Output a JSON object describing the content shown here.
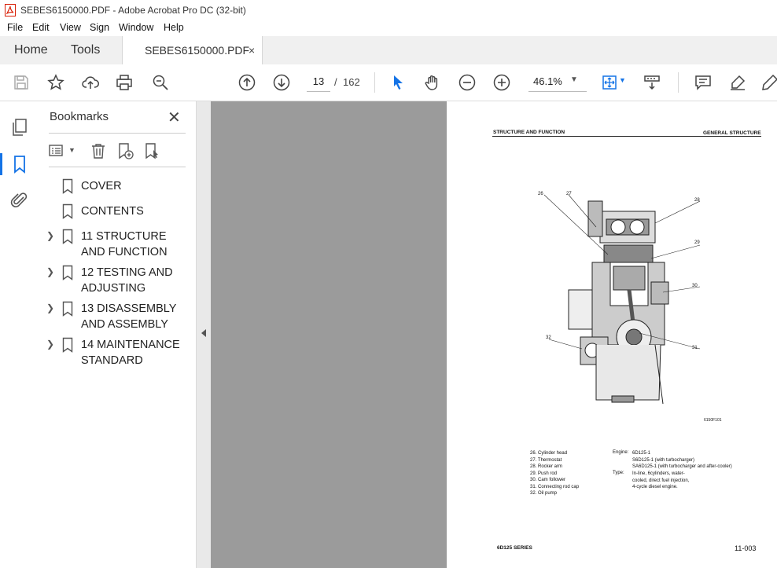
{
  "window": {
    "title": "SEBES6150000.PDF - Adobe Acrobat Pro DC (32-bit)"
  },
  "menu": [
    "File",
    "Edit",
    "View",
    "Sign",
    "Window",
    "Help"
  ],
  "tabs": {
    "home": "Home",
    "tools": "Tools",
    "document": "SEBES6150000.PDF",
    "close": "×"
  },
  "toolbar": {
    "page_current": "13",
    "page_sep": "/",
    "page_total": "162",
    "zoom": "46.1%"
  },
  "bookmarks": {
    "title": "Bookmarks",
    "close": "✕",
    "items": [
      {
        "label": "COVER",
        "expandable": false
      },
      {
        "label": "CONTENTS",
        "expandable": false
      },
      {
        "label": "11 STRUCTURE AND FUNCTION",
        "expandable": true
      },
      {
        "label": "12 TESTING AND ADJUSTING",
        "expandable": true
      },
      {
        "label": "13 DISASSEMBLY AND ASSEMBLY",
        "expandable": true
      },
      {
        "label": "14 MAINTENANCE STANDARD",
        "expandable": true
      }
    ]
  },
  "pdf_page": {
    "header_left": "STRUCTURE AND FUNCTION",
    "header_right": "GENERAL STRUCTURE",
    "callouts": [
      "26",
      "27",
      "28",
      "29",
      "30",
      "31",
      "32"
    ],
    "figure_id": "6150F101",
    "legend": [
      "26.  Cylinder head",
      "27.  Thermostat",
      "28.  Rocker arm",
      "29.  Push rod",
      "30.  Cam follower",
      "31.  Connecting rod cap",
      "32.  Oil pump"
    ],
    "engine_label": "Engine:",
    "engine_lines": [
      "6D125-1",
      "S6D125-1 (with turbocharger)",
      "SA6D125-1 (with turbocharger and after-cooler)"
    ],
    "type_label": "Type:",
    "type_lines": [
      "In-line,   6cylinders,   water-",
      "cooled,   direct   fuel  injection,",
      "4-cycle diesel engine."
    ],
    "footer_left": "6D125 SERIES",
    "footer_right": "11-003"
  },
  "colors": {
    "accent": "#1473e6",
    "doc_bg": "#9b9b9b",
    "acrobat_red": "#d81e05"
  }
}
